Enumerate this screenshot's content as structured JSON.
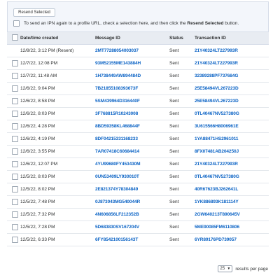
{
  "toolbar": {
    "resend_label": "Resend Selected",
    "instruction_prefix": "To send an IPN again to a profile URL, check a selection here, and then click the",
    "instruction_bold": "Resend Selected",
    "instruction_suffix": " button."
  },
  "table": {
    "columns": [
      "Date/time created",
      "Message ID",
      "Status",
      "Transaction ID"
    ],
    "rows": [
      {
        "date": "12/8/22, 3:12 PM (Resent)",
        "message_id": "2MT77288054003037",
        "status": "Sent",
        "transaction_id": "21Y40324LT227993R",
        "checkbox": false
      },
      {
        "date": "12/7/22, 12:08 PM",
        "message_id": "93M52155ME143884H",
        "status": "Sent",
        "transaction_id": "21Y40324LT227993R",
        "checkbox": true
      },
      {
        "date": "12/7/22, 11:48 AM",
        "message_id": "1H738449AW894484D",
        "status": "Sent",
        "transaction_id": "32389288PF737684G",
        "checkbox": true
      },
      {
        "date": "12/6/22, 9:04 PM",
        "message_id": "7B21855108393673F",
        "status": "Sent",
        "transaction_id": "25E58494VL267223D",
        "checkbox": true
      },
      {
        "date": "12/6/22, 8:58 PM",
        "message_id": "5SM439964D316440F",
        "status": "Sent",
        "transaction_id": "25E58494VL267223D",
        "checkbox": true
      },
      {
        "date": "12/6/22, 8:03 PM",
        "message_id": "3F768815R10243008",
        "status": "Sent",
        "transaction_id": "0TL40467NV527380G",
        "checkbox": true
      },
      {
        "date": "12/6/22, 4:28 PM",
        "message_id": "8BD59358KL468844F",
        "status": "Sent",
        "transaction_id": "3U615566H8006961E",
        "checkbox": true
      },
      {
        "date": "12/6/22, 4:19 PM",
        "message_id": "8DF04215331168233",
        "status": "Sent",
        "transaction_id": "1YA88471HS2961011",
        "checkbox": true
      },
      {
        "date": "12/6/22, 3:55 PM",
        "message_id": "7AR07418C60684414",
        "status": "Sent",
        "transaction_id": "8FX07481AB204250J",
        "checkbox": true
      },
      {
        "date": "12/6/22, 12:07 PM",
        "message_id": "4YU99680FY453430M",
        "status": "Sent",
        "transaction_id": "21Y40324LT227993R",
        "checkbox": true
      },
      {
        "date": "12/5/22, 8:03 PM",
        "message_id": "0UN53409LY930010T",
        "status": "Sent",
        "transaction_id": "0TL40467NV527380G",
        "checkbox": true
      },
      {
        "date": "12/5/22, 8:02 PM",
        "message_id": "2E821374Y78304849",
        "status": "Sent",
        "transaction_id": "40R67623BJ262641L",
        "checkbox": true
      },
      {
        "date": "12/5/22, 7:48 PM",
        "message_id": "0J873043MG540044R",
        "status": "Sent",
        "transaction_id": "1YK886893K181114Y",
        "checkbox": true
      },
      {
        "date": "12/5/22, 7:32 PM",
        "message_id": "4N606856LF212352B",
        "status": "Sent",
        "transaction_id": "2GW640213T890645V",
        "checkbox": true
      },
      {
        "date": "12/5/22, 7:28 PM",
        "message_id": "5D683830SV167204V",
        "status": "Sent",
        "transaction_id": "5ME90085FM6110806",
        "checkbox": true
      },
      {
        "date": "12/5/22, 6:33 PM",
        "message_id": "6FY8542100156143T",
        "status": "Sent",
        "transaction_id": "6YR89176PD739057",
        "checkbox": true
      }
    ]
  },
  "pagination": {
    "per_page_value": "25",
    "per_page_label": "results per page"
  },
  "colors": {
    "link": "#0b63c5",
    "header_bg": "#e8ecf2",
    "panel_bg": "#f3f6fb"
  }
}
